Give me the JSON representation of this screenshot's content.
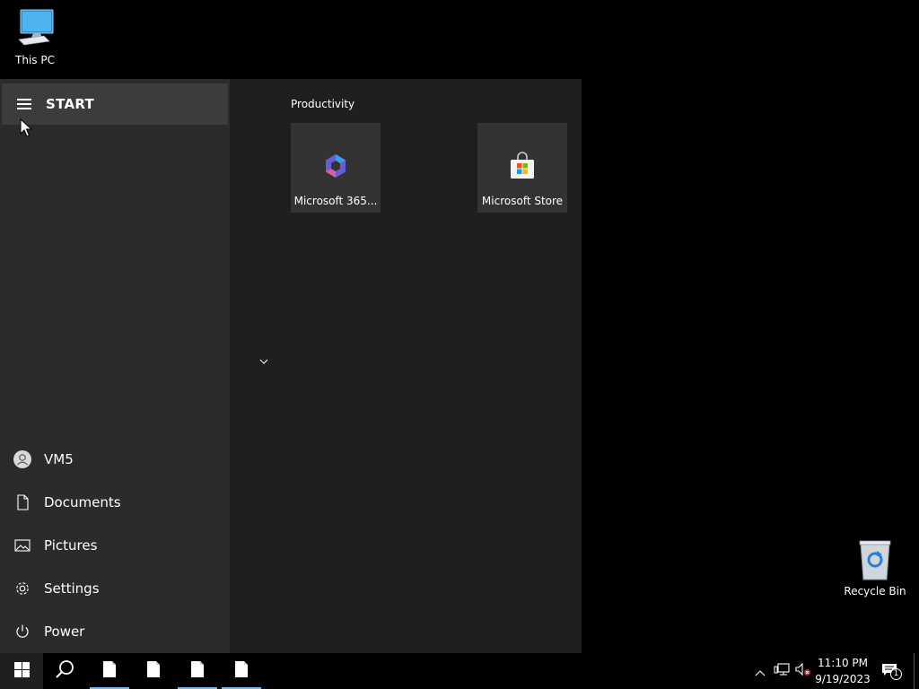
{
  "desktop": {
    "icons": [
      {
        "label": "This PC",
        "icon": "computer-icon"
      },
      {
        "label": "Recycle Bin",
        "icon": "recycle-bin-icon"
      }
    ]
  },
  "start_menu": {
    "title": "START",
    "left_items": [
      {
        "label": "VM5",
        "icon": "user-avatar-icon"
      },
      {
        "label": "Documents",
        "icon": "document-icon"
      },
      {
        "label": "Pictures",
        "icon": "pictures-icon"
      },
      {
        "label": "Settings",
        "icon": "gear-icon"
      },
      {
        "label": "Power",
        "icon": "power-icon"
      }
    ],
    "group_title": "Productivity",
    "tiles": [
      {
        "label": "Microsoft 365...",
        "icon": "microsoft-365-icon"
      },
      {
        "label": "Microsoft Store",
        "icon": "microsoft-store-icon"
      }
    ]
  },
  "taskbar": {
    "clock_time": "11:10 PM",
    "clock_date": "9/19/2023",
    "notification_count": "1",
    "accent_color": "#76b9ed",
    "pinned": [
      {
        "icon": "windows-logo-icon"
      },
      {
        "icon": "search-icon"
      },
      {
        "icon": "file-icon"
      },
      {
        "icon": "file-icon"
      },
      {
        "icon": "file-icon"
      },
      {
        "icon": "file-icon"
      }
    ]
  }
}
